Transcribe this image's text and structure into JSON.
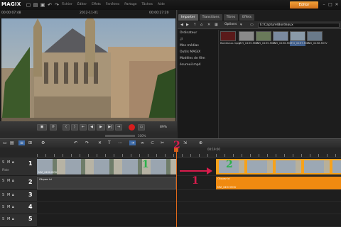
{
  "app": {
    "logo": "MAGIX",
    "editor_button": "Editor"
  },
  "menu": [
    "Fichier",
    "Éditer",
    "Effets",
    "Fenêtres",
    "Partage",
    "Tâches",
    "Aide"
  ],
  "monitor": {
    "time_left": "00:00:07:48",
    "date": "2012-11-01",
    "time_right": "00:00:27:20"
  },
  "transport": {
    "zoom": "89%",
    "volume_pct": "100%"
  },
  "media_pool": {
    "tabs": [
      "Importer",
      "Transitions",
      "Titres",
      "Effets"
    ],
    "active_tab": 0,
    "options_label": "Options",
    "path": "E:\\Capture\\Bordeaux",
    "folders": [
      "Ordinateur",
      "Mes médias",
      "Outils MAGIX",
      "Modèles de film",
      "écureuil.mp4"
    ],
    "files": [
      {
        "name": "Bordeaux.mpg",
        "color": "#5a1a1a"
      },
      {
        "name": "MVI_0495.MOV",
        "color": "#8a8a8a"
      },
      {
        "name": "MVI_0495.MOV",
        "color": "#6a7a5a"
      },
      {
        "name": "MVI_0496.MOV",
        "color": "#7a8aa0"
      },
      {
        "name": "MVI_0497.MOV",
        "color": "#8a9aa8"
      },
      {
        "name": "MVI_0498.MOV",
        "color": "#6a7a8a"
      }
    ]
  },
  "timeline": {
    "ruler_time": "00:19:00",
    "tracks": [
      {
        "number": "1",
        "name": "Piste"
      },
      {
        "number": "2",
        "name": ""
      },
      {
        "number": "3",
        "name": ""
      },
      {
        "number": "4",
        "name": ""
      },
      {
        "number": "5",
        "name": ""
      }
    ],
    "clip1_label": "MVI_0490.MOV",
    "clip2_label": "MVI_0497.MOV",
    "clip2_track_label": "MVI_0497.MOV",
    "audio_label": "Cliquez ici"
  },
  "annotations": {
    "one": "1",
    "two": "2",
    "green_one": "1",
    "green_two": "2"
  },
  "colors": {
    "accent": "#f2a23a",
    "clip_orange": "#f7a21b",
    "playhead": "#e06a1a",
    "annotation_red": "#d81c4c",
    "annotation_green": "#2bb14a"
  }
}
